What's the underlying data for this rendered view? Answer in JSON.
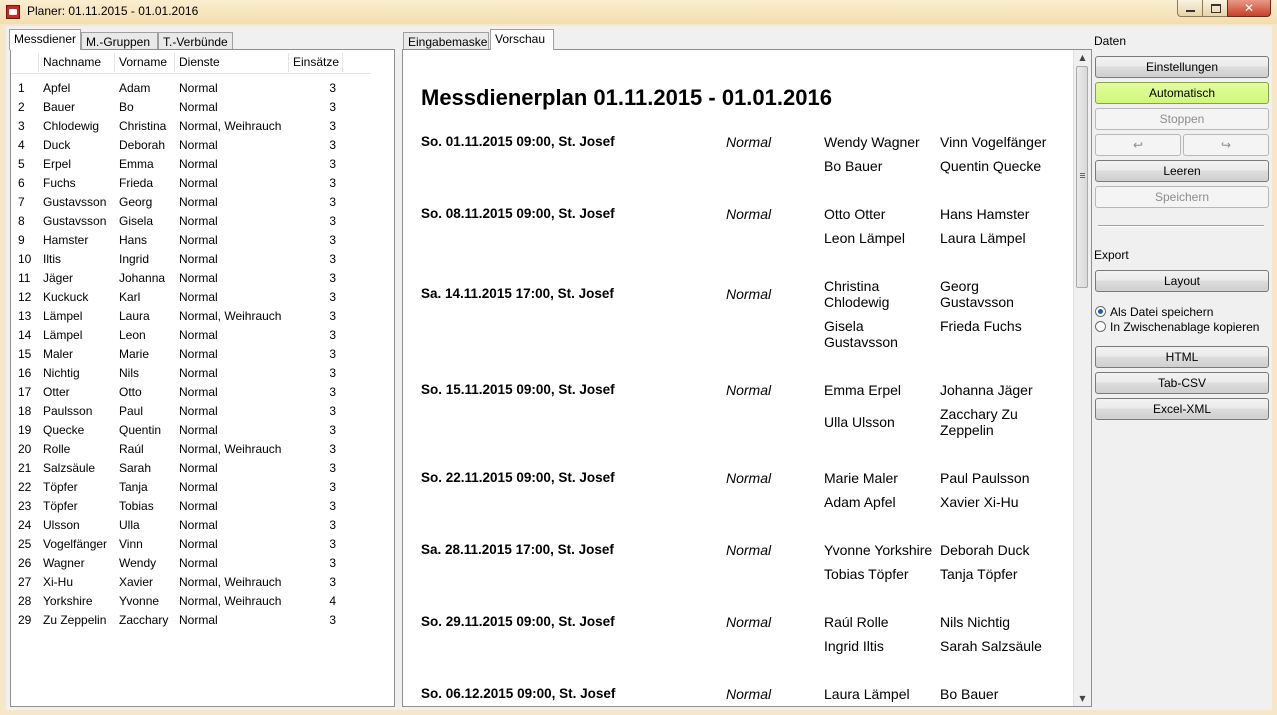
{
  "window": {
    "title": "Planer: 01.11.2015 - 01.01.2016"
  },
  "left_tabs": [
    "Messdiener",
    "M.-Gruppen",
    "T.-Verbünde"
  ],
  "center_tabs": [
    "Eingabemaske",
    "Vorschau"
  ],
  "list": {
    "columns": [
      "Nachname",
      "Vorname",
      "Dienste",
      "Einsätze"
    ],
    "rows": [
      [
        "1",
        "Apfel",
        "Adam",
        "Normal",
        "3"
      ],
      [
        "2",
        "Bauer",
        "Bo",
        "Normal",
        "3"
      ],
      [
        "3",
        "Chlodewig",
        "Christina",
        "Normal, Weihrauch",
        "3"
      ],
      [
        "4",
        "Duck",
        "Deborah",
        "Normal",
        "3"
      ],
      [
        "5",
        "Erpel",
        "Emma",
        "Normal",
        "3"
      ],
      [
        "6",
        "Fuchs",
        "Frieda",
        "Normal",
        "3"
      ],
      [
        "7",
        "Gustavsson",
        "Georg",
        "Normal",
        "3"
      ],
      [
        "8",
        "Gustavsson",
        "Gisela",
        "Normal",
        "3"
      ],
      [
        "9",
        "Hamster",
        "Hans",
        "Normal",
        "3"
      ],
      [
        "10",
        "Iltis",
        "Ingrid",
        "Normal",
        "3"
      ],
      [
        "11",
        "Jäger",
        "Johanna",
        "Normal",
        "3"
      ],
      [
        "12",
        "Kuckuck",
        "Karl",
        "Normal",
        "3"
      ],
      [
        "13",
        "Lämpel",
        "Laura",
        "Normal, Weihrauch",
        "3"
      ],
      [
        "14",
        "Lämpel",
        "Leon",
        "Normal",
        "3"
      ],
      [
        "15",
        "Maler",
        "Marie",
        "Normal",
        "3"
      ],
      [
        "16",
        "Nichtig",
        "Nils",
        "Normal",
        "3"
      ],
      [
        "17",
        "Otter",
        "Otto",
        "Normal",
        "3"
      ],
      [
        "18",
        "Paulsson",
        "Paul",
        "Normal",
        "3"
      ],
      [
        "19",
        "Quecke",
        "Quentin",
        "Normal",
        "3"
      ],
      [
        "20",
        "Rolle",
        "Raúl",
        "Normal, Weihrauch",
        "3"
      ],
      [
        "21",
        "Salzsäule",
        "Sarah",
        "Normal",
        "3"
      ],
      [
        "22",
        "Töpfer",
        "Tanja",
        "Normal",
        "3"
      ],
      [
        "23",
        "Töpfer",
        "Tobias",
        "Normal",
        "3"
      ],
      [
        "24",
        "Ulsson",
        "Ulla",
        "Normal",
        "3"
      ],
      [
        "25",
        "Vogelfänger",
        "Vinn",
        "Normal",
        "3"
      ],
      [
        "26",
        "Wagner",
        "Wendy",
        "Normal",
        "3"
      ],
      [
        "27",
        "Xi-Hu",
        "Xavier",
        "Normal, Weihrauch",
        "3"
      ],
      [
        "28",
        "Yorkshire",
        "Yvonne",
        "Normal, Weihrauch",
        "4"
      ],
      [
        "29",
        "Zu Zeppelin",
        "Zacchary",
        "Normal",
        "3"
      ]
    ]
  },
  "preview": {
    "title": "Messdienerplan 01.11.2015 - 01.01.2016",
    "entries": [
      {
        "date": "So. 01.11.2015 09:00, St. Josef",
        "type": "Normal",
        "names": [
          "Wendy Wagner",
          "Vinn Vogelfänger",
          "Bo Bauer",
          "Quentin Quecke"
        ]
      },
      {
        "date": "So. 08.11.2015 09:00, St. Josef",
        "type": "Normal",
        "names": [
          "Otto Otter",
          "Hans Hamster",
          "Leon Lämpel",
          "Laura Lämpel"
        ]
      },
      {
        "date": "Sa. 14.11.2015 17:00, St. Josef",
        "type": "Normal",
        "names": [
          "Christina Chlodewig",
          "Georg Gustavsson",
          "Gisela Gustavsson",
          "Frieda Fuchs"
        ]
      },
      {
        "date": "So. 15.11.2015 09:00, St. Josef",
        "type": "Normal",
        "names": [
          "Emma Erpel",
          "Johanna Jäger",
          "Ulla Ulsson",
          "Zacchary Zu Zeppelin"
        ]
      },
      {
        "date": "So. 22.11.2015 09:00, St. Josef",
        "type": "Normal",
        "names": [
          "Marie Maler",
          "Paul Paulsson",
          "Adam Apfel",
          "Xavier Xi-Hu"
        ]
      },
      {
        "date": "Sa. 28.11.2015 17:00, St. Josef",
        "type": "Normal",
        "names": [
          "Yvonne Yorkshire",
          "Deborah Duck",
          "Tobias Töpfer",
          "Tanja Töpfer"
        ]
      },
      {
        "date": "So. 29.11.2015 09:00, St. Josef",
        "type": "Normal",
        "names": [
          "Raúl Rolle",
          "Nils Nichtig",
          "Ingrid Iltis",
          "Sarah Salzsäule"
        ]
      },
      {
        "date": "So. 06.12.2015 09:00, St. Josef",
        "type": "Normal",
        "names": [
          "Laura Lämpel",
          "Bo Bauer"
        ]
      }
    ]
  },
  "sidebar": {
    "daten_label": "Daten",
    "einstellungen": "Einstellungen",
    "automatisch": "Automatisch",
    "stoppen": "Stoppen",
    "undo_glyph": "↩",
    "redo_glyph": "↪",
    "leeren": "Leeren",
    "speichern": "Speichern",
    "export_label": "Export",
    "layout": "Layout",
    "radio_file": "Als Datei speichern",
    "radio_clipboard": "In Zwischenablage kopieren",
    "html": "HTML",
    "tabcsv": "Tab-CSV",
    "excelxml": "Excel-XML"
  },
  "colors": {
    "accent_green": "#cff87a",
    "title_bg": "#f6e7c8",
    "close_red": "#c6412a"
  }
}
